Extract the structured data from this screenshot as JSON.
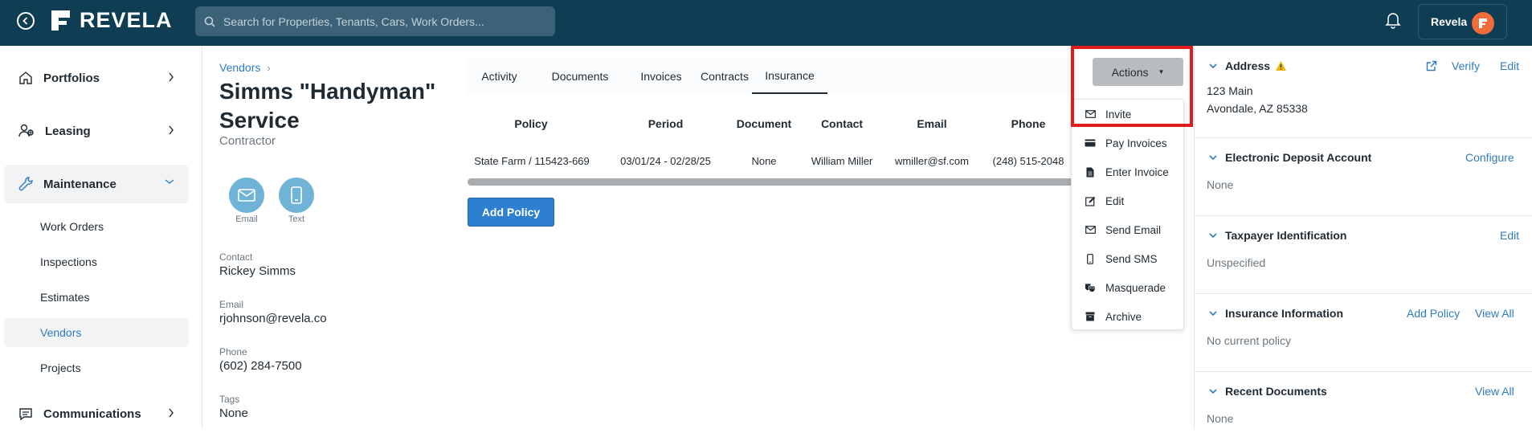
{
  "topbar": {
    "brand": "REVELA",
    "search_placeholder": "Search for Properties, Tenants, Cars, Work Orders...",
    "user_name": "Revela"
  },
  "sidebar": {
    "groups": [
      {
        "label": "Portfolios"
      },
      {
        "label": "Leasing"
      },
      {
        "label": "Maintenance"
      },
      {
        "label": "Communications"
      }
    ],
    "maintenance_items": [
      {
        "label": "Work Orders"
      },
      {
        "label": "Inspections"
      },
      {
        "label": "Estimates"
      },
      {
        "label": "Vendors"
      },
      {
        "label": "Projects"
      }
    ]
  },
  "vendor": {
    "breadcrumb": "Vendors",
    "title": "Simms \"Handyman\" Service",
    "type": "Contractor",
    "email_action": "Email",
    "text_action": "Text",
    "contact_label": "Contact",
    "contact_value": "Rickey Simms",
    "email_label": "Email",
    "email_value": "rjohnson@revela.co",
    "phone_label": "Phone",
    "phone_value": "(602) 284-7500",
    "tags_label": "Tags",
    "tags_value": "None"
  },
  "tabs": [
    "Activity",
    "Documents",
    "Invoices",
    "Contracts",
    "Insurance"
  ],
  "insurance_table": {
    "headers": [
      "Policy",
      "Period",
      "Document",
      "Contact",
      "Email",
      "Phone"
    ],
    "row": [
      "State Farm / 115423-669",
      "03/01/24 - 02/28/25",
      "None",
      "William Miller",
      "wmiller@sf.com",
      "(248) 515-2048"
    ],
    "add_policy": "Add Policy"
  },
  "actions": {
    "label": "Actions",
    "menu": [
      "Invite",
      "Pay Invoices",
      "Enter Invoice",
      "Edit",
      "Send Email",
      "Send SMS",
      "Masquerade",
      "Archive"
    ]
  },
  "right": {
    "address": {
      "title": "Address",
      "verify": "Verify",
      "edit": "Edit",
      "line1": "123 Main",
      "line2": "Avondale, AZ 85338"
    },
    "deposit": {
      "title": "Electronic Deposit Account",
      "configure": "Configure",
      "value": "None"
    },
    "taxpayer": {
      "title": "Taxpayer Identification",
      "edit": "Edit",
      "value": "Unspecified"
    },
    "insurance": {
      "title": "Insurance Information",
      "add_policy": "Add Policy",
      "view_all": "View All",
      "value": "No current policy"
    },
    "documents": {
      "title": "Recent Documents",
      "view_all": "View All",
      "value": "None"
    }
  },
  "colors": {
    "topbar": "#0f3e54",
    "accent": "#2f7bbf",
    "highlight": "#e01b1b",
    "warning": "#f2b705"
  }
}
